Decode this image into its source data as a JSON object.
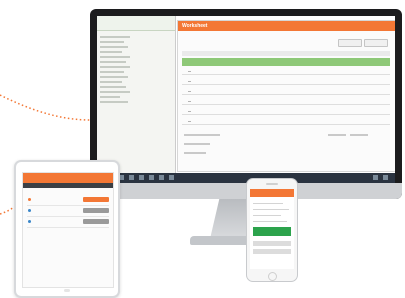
{
  "scene": "devices",
  "web_app": {
    "brand": "Worksheet"
  },
  "tablet_app": {
    "items": [
      {
        "icon": "circle-icon",
        "color": "#f37735"
      },
      {
        "icon": "circle-icon",
        "color": "#3a86c8"
      },
      {
        "icon": "circle-icon",
        "color": "#3a86c8"
      }
    ]
  },
  "colors": {
    "accent": "#f37735",
    "highlight_row": "#8ec877",
    "phone_action": "#2ca34c"
  }
}
